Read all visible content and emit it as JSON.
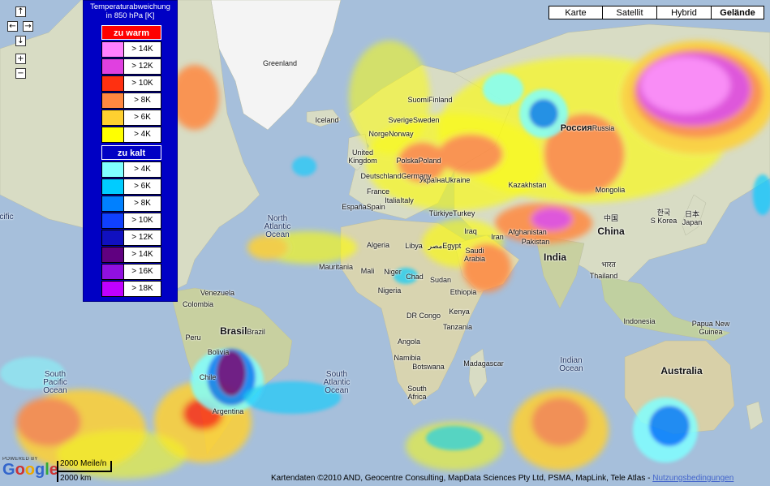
{
  "nav": {
    "up": "↑",
    "left": "←",
    "right": "→",
    "down": "↓",
    "zoom_in": "+",
    "zoom_out": "−"
  },
  "map_types": [
    {
      "label": "Karte",
      "active": false
    },
    {
      "label": "Satellit",
      "active": false
    },
    {
      "label": "Hybrid",
      "active": false
    },
    {
      "label": "Gelände",
      "active": true
    }
  ],
  "legend": {
    "title_line1": "Temperaturabweichung",
    "title_line2": "in 850 hPa [K]",
    "warm_header": "zu warm",
    "cold_header": "zu kalt",
    "warm_color": "#ff0000",
    "cold_color": "#0000c4",
    "warm": [
      {
        "label": "> 14K",
        "color": "#ff80ff"
      },
      {
        "label": "> 12K",
        "color": "#e040e0"
      },
      {
        "label": "> 10K",
        "color": "#ff3010"
      },
      {
        "label": "> 8K",
        "color": "#ff8840"
      },
      {
        "label": "> 6K",
        "color": "#ffd030"
      },
      {
        "label": "> 4K",
        "color": "#ffff00"
      }
    ],
    "cold": [
      {
        "label": "> 4K",
        "color": "#80ffff"
      },
      {
        "label": "> 6K",
        "color": "#00ccff"
      },
      {
        "label": "> 8K",
        "color": "#0080ff"
      },
      {
        "label": "> 10K",
        "color": "#1040ff"
      },
      {
        "label": "> 12K",
        "color": "#1010c0"
      },
      {
        "label": "> 14K",
        "color": "#600080"
      },
      {
        "label": "> 16K",
        "color": "#9010e0"
      },
      {
        "label": "> 18K",
        "color": "#c000ff"
      }
    ]
  },
  "places": {
    "greenland": "Greenland",
    "iceland": "Iceland",
    "suomi": "Suomi",
    "finland": "Finland",
    "norge": "Norge",
    "norway": "Norway",
    "sverige": "Sverige",
    "sweden": "Sweden",
    "uk1": "United",
    "uk2": "Kingdom",
    "deutschland": "Deutschland",
    "germany": "Germany",
    "polska": "Polska",
    "poland": "Poland",
    "ukraina_local": "Україна",
    "ukraine": "Ukraine",
    "rossiya": "Россия",
    "russia": "Russia",
    "france": "France",
    "italia": "Italia",
    "italy": "Italy",
    "espana": "España",
    "spain": "Spain",
    "turkiye": "Türkiye",
    "turkey": "Turkey",
    "kazakhstan": "Kazakhstan",
    "mongolia": "Mongolia",
    "china_local": "中国",
    "china": "China",
    "skorea_local": "한국",
    "skorea": "S Korea",
    "japan_local": "日本",
    "japan": "Japan",
    "iraq": "Iraq",
    "iran": "Iran",
    "afghanistan": "Afghanistan",
    "pakistan": "Pakistan",
    "india_local": "भारत",
    "india": "India",
    "thailand": "Thailand",
    "indonesia": "Indonesia",
    "png1": "Papua New",
    "png2": "Guinea",
    "australia": "Australia",
    "algeria": "Algeria",
    "libya": "Libya",
    "egypt_local": "مصر",
    "egypt": "Egypt",
    "mauritania": "Mauritania",
    "mali": "Mali",
    "niger": "Niger",
    "chad": "Chad",
    "sudan": "Sudan",
    "nigeria": "Nigeria",
    "ethiopia": "Ethiopia",
    "drcongo": "DR Congo",
    "kenya": "Kenya",
    "tanzania": "Tanzania",
    "angola": "Angola",
    "namibia": "Namibia",
    "botswana": "Botswana",
    "southafrica1": "South",
    "southafrica2": "Africa",
    "madagascar": "Madagascar",
    "saudi1": "Saudi",
    "saudi2": "Arabia",
    "venezuela": "Venezuela",
    "colombia": "Colombia",
    "peru": "Peru",
    "brasil": "Brasil",
    "brazil": "Brazil",
    "bolivia": "Bolivia",
    "chile": "Chile",
    "argentina": "Argentina",
    "na_ocean1": "North",
    "na_ocean2": "Atlantic",
    "na_ocean3": "Ocean",
    "sa_ocean1": "South",
    "sa_ocean2": "Atlantic",
    "sa_ocean3": "Ocean",
    "sp_ocean1": "South",
    "sp_ocean2": "Pacific",
    "sp_ocean3": "Ocean",
    "io1": "Indian",
    "io2": "Ocean",
    "pacific_edge": "cific"
  },
  "footer": {
    "powered_by": "POWERED BY",
    "google": "Google",
    "scale_miles": "2000 Meile/n",
    "scale_km": "2000 km",
    "attribution": "Kartendaten ©2010 AND, Geocentre Consulting, MapData Sciences Pty Ltd, PSMA, MapLink, Tele Atlas - ",
    "terms": "Nutzungsbedingungen"
  }
}
